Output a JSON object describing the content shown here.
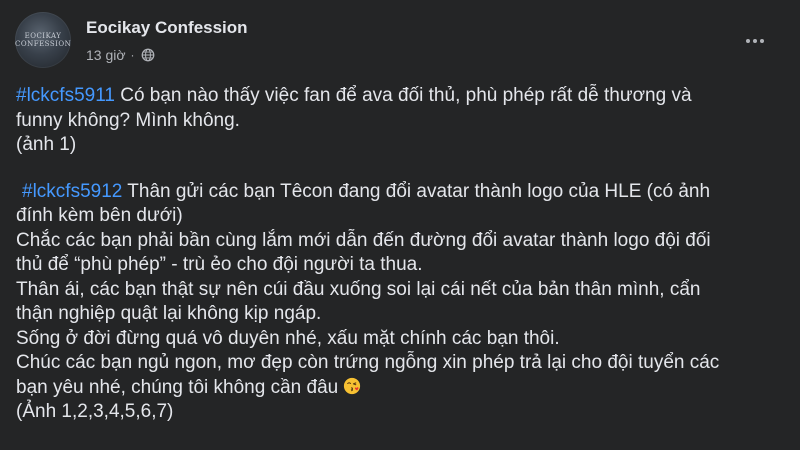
{
  "post": {
    "page_name": "Eocikay Confession",
    "timestamp": "13 giờ",
    "separator": "·",
    "avatar_text_1": "EOCIKAY",
    "avatar_text_2": "CONFESSION",
    "privacy_icon": "globe-icon",
    "menu_icon": "more-options-icon"
  },
  "first_confession": {
    "hashtag": "#lckcfs5911",
    "line1": " Có bạn nào thấy việc fan để ava đối thủ, phù phép rất dễ thương và",
    "line2": "funny không? Mình không.",
    "line3": "(ảnh 1)"
  },
  "second_confession": {
    "hashtag": "#lckcfs5912",
    "line1": " Thân gửi các bạn Têcon đang đổi avatar thành logo của HLE (có ảnh",
    "line2": "đính kèm bên dưới)",
    "line3": "Chắc các bạn phải bần cùng lắm mới dẫn đến đường đổi avatar thành logo đội đối",
    "line4": "thủ để “phù phép” - trù ẻo cho đội người ta thua.",
    "line5": "Thân ái, các bạn thật sự nên cúi đầu xuống soi lại cái nết của bản thân mình, cẩn",
    "line6": "thận nghiệp quật lại không kịp ngáp.",
    "line7": "Sống ở đời đừng quá vô duyên nhé, xấu mặt chính các bạn thôi.",
    "line8": "Chúc các bạn ngủ ngon, mơ đẹp còn trứng ngỗng xin phép trả lại cho đội tuyển các",
    "line9": "bạn yêu nhé, chúng tôi không cần đâu",
    "line10": "(Ảnh 1,2,3,4,5,6,7)",
    "emoji_icon": "kissing-face-emoji-icon"
  },
  "colors": {
    "background": "#242526",
    "text": "#e4e6eb",
    "secondary_text": "#b0b3b8",
    "hashtag": "#4599ff"
  }
}
